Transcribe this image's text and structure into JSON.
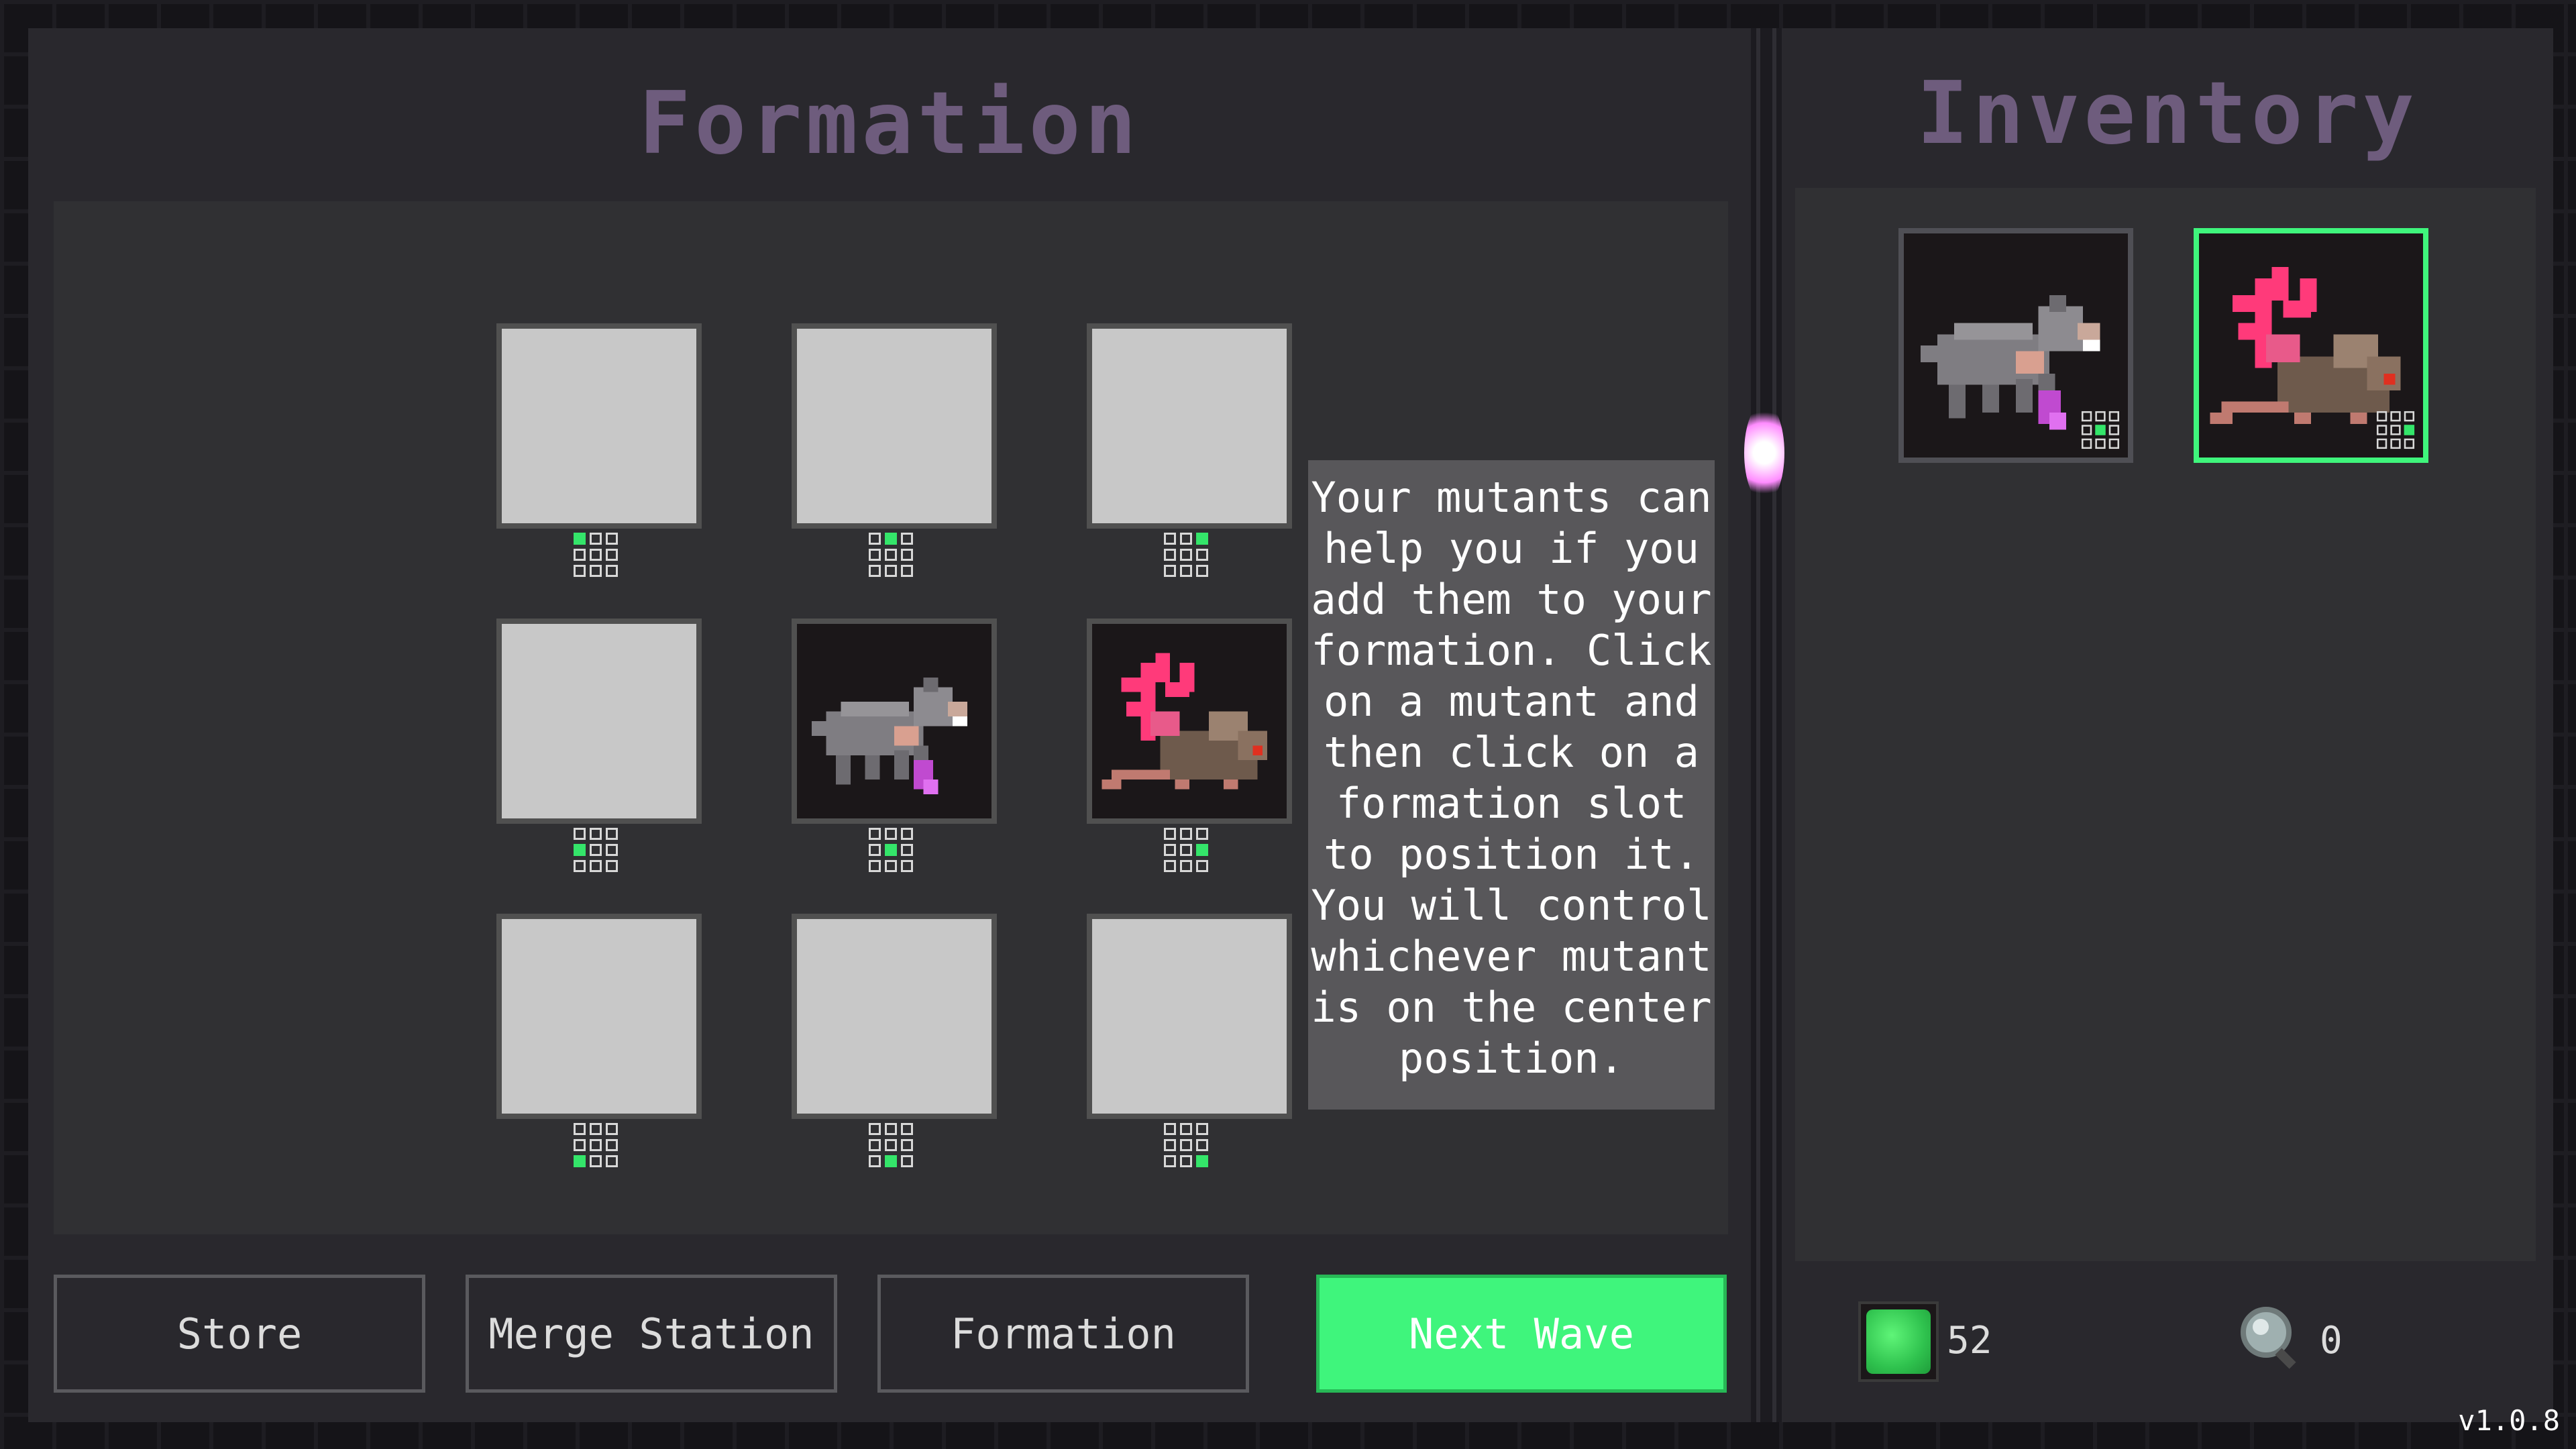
{
  "formation": {
    "title": "Formation",
    "slots": [
      {
        "id": "top-left",
        "mutant": null,
        "pip": 0
      },
      {
        "id": "top-center",
        "mutant": null,
        "pip": 1
      },
      {
        "id": "top-right",
        "mutant": null,
        "pip": 2
      },
      {
        "id": "middle-left",
        "mutant": null,
        "pip": 3
      },
      {
        "id": "center",
        "mutant": "wolf-mutant-icon",
        "pip": 4
      },
      {
        "id": "middle-right",
        "mutant": "coral-rat-mutant-icon",
        "pip": 5
      },
      {
        "id": "bottom-left",
        "mutant": null,
        "pip": 6
      },
      {
        "id": "bottom-center",
        "mutant": null,
        "pip": 7
      },
      {
        "id": "bottom-right",
        "mutant": null,
        "pip": 8
      }
    ],
    "info_text": "Your mutants can\nhelp you if you\nadd them to your\nformation. Click\non a mutant and\nthen click on a\nformation slot\nto position it.\nYou will control\nwhichever mutant\nis on the center\nposition."
  },
  "buttons": {
    "store_label": "Store",
    "merge_label": "Merge Station",
    "formation_label": "Formation",
    "next_wave_label": "Next Wave"
  },
  "inventory": {
    "title": "Inventory",
    "items": [
      {
        "icon": "wolf-mutant-icon",
        "selected": false
      },
      {
        "icon": "coral-rat-mutant-icon",
        "selected": true
      }
    ]
  },
  "currency": {
    "gems_icon": "green-gem-icon",
    "gems": "52",
    "lens_icon": "magnifier-icon",
    "lens": "0"
  },
  "version": "v1.0.8",
  "colors": {
    "accent_green": "#3ff57c",
    "title_purple": "#6e5c7d",
    "panel": "#29282d"
  }
}
